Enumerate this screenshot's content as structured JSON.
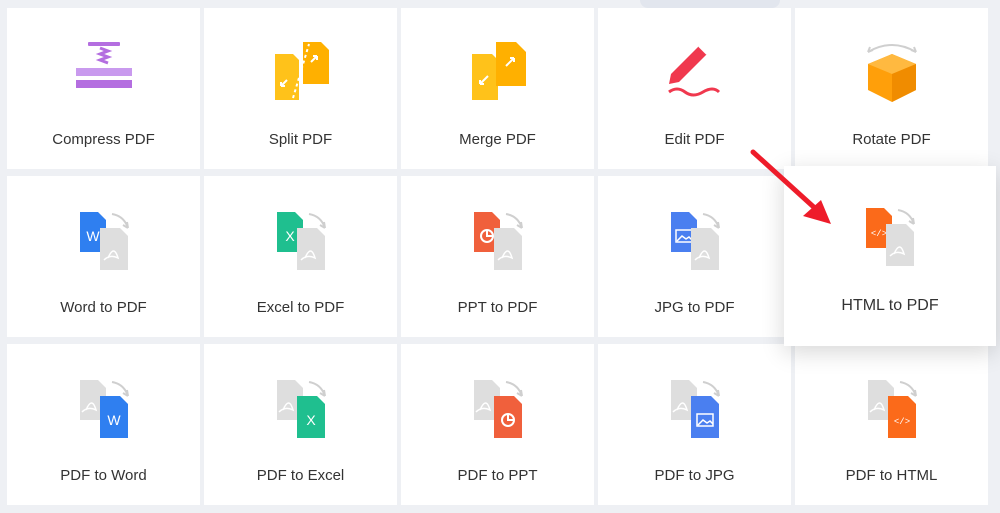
{
  "tools": [
    {
      "id": "compress",
      "label": "Compress PDF",
      "icon": "compress-icon"
    },
    {
      "id": "split",
      "label": "Split PDF",
      "icon": "split-icon"
    },
    {
      "id": "merge",
      "label": "Merge PDF",
      "icon": "merge-icon"
    },
    {
      "id": "edit",
      "label": "Edit PDF",
      "icon": "edit-icon"
    },
    {
      "id": "rotate",
      "label": "Rotate PDF",
      "icon": "rotate-icon"
    },
    {
      "id": "word2pdf",
      "label": "Word to PDF",
      "icon": "word-to-pdf-icon"
    },
    {
      "id": "excel2pdf",
      "label": "Excel to PDF",
      "icon": "excel-to-pdf-icon"
    },
    {
      "id": "ppt2pdf",
      "label": "PPT to PDF",
      "icon": "ppt-to-pdf-icon"
    },
    {
      "id": "jpg2pdf",
      "label": "JPG to PDF",
      "icon": "jpg-to-pdf-icon"
    },
    {
      "id": "html2pdf",
      "label": "HTML to PDF",
      "icon": "html-to-pdf-icon"
    },
    {
      "id": "pdf2word",
      "label": "PDF to Word",
      "icon": "pdf-to-word-icon"
    },
    {
      "id": "pdf2excel",
      "label": "PDF to Excel",
      "icon": "pdf-to-excel-icon"
    },
    {
      "id": "pdf2ppt",
      "label": "PDF to PPT",
      "icon": "pdf-to-ppt-icon"
    },
    {
      "id": "pdf2jpg",
      "label": "PDF to JPG",
      "icon": "pdf-to-jpg-icon"
    },
    {
      "id": "pdf2html",
      "label": "PDF to HTML",
      "icon": "pdf-to-html-icon"
    }
  ],
  "highlighted_tool": "html2pdf",
  "colors": {
    "word": "#2f7ff0",
    "excel": "#1fbf8f",
    "ppt": "#f0603c",
    "jpg": "#4a7ff0",
    "html": "#fb6a1a",
    "pdf_gray": "#dedede",
    "compress": "#b46ee0",
    "yellow": "#ffc21a",
    "edit": "#f0384e",
    "rotate": "#ff9f0a",
    "arrow": "#ee1c2a"
  }
}
